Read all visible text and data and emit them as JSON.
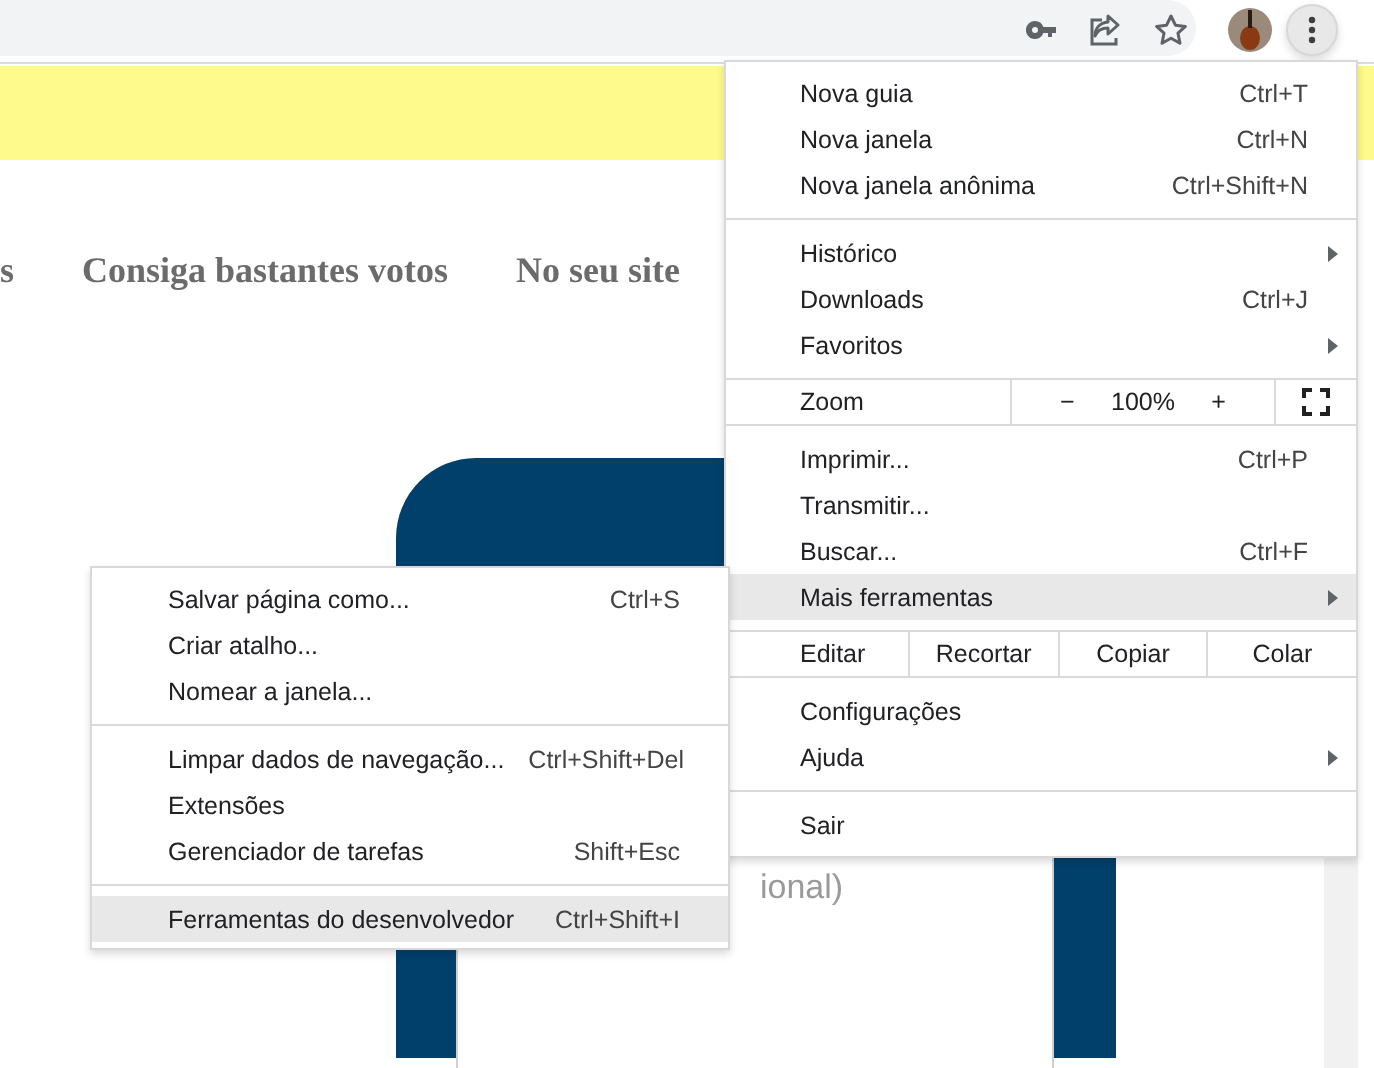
{
  "toolbar": {
    "icons": [
      {
        "kind": "key"
      },
      {
        "kind": "share"
      },
      {
        "kind": "star"
      },
      {
        "kind": "avatar"
      },
      {
        "kind": "menu",
        "selected": true
      }
    ]
  },
  "nav": {
    "links": [
      "s",
      "Consiga bastantes votos",
      "No seu site"
    ]
  },
  "form": {
    "field": {
      "placeholder": "ional)"
    }
  },
  "main_menu": {
    "items": [
      {
        "kind": "item",
        "label": "Nova guia",
        "shortcut": "Ctrl+T",
        "submenu": false,
        "selected": false
      },
      {
        "kind": "item",
        "label": "Nova janela",
        "shortcut": "Ctrl+N",
        "submenu": false,
        "selected": false
      },
      {
        "kind": "item",
        "label": "Nova janela anônima",
        "shortcut": "Ctrl+Shift+N",
        "submenu": false,
        "selected": false
      },
      {
        "kind": "separator"
      },
      {
        "kind": "item",
        "label": "Histórico",
        "submenu": true,
        "selected": false
      },
      {
        "kind": "item",
        "label": "Downloads",
        "shortcut": "Ctrl+J",
        "submenu": false,
        "selected": false
      },
      {
        "kind": "item",
        "label": "Favoritos",
        "submenu": true,
        "selected": false
      },
      {
        "kind": "zoom",
        "label": "Zoom",
        "minus": "−",
        "value": "100%",
        "plus": "+"
      },
      {
        "kind": "item",
        "label": "Imprimir...",
        "shortcut": "Ctrl+P",
        "submenu": false,
        "selected": false
      },
      {
        "kind": "item",
        "label": "Transmitir...",
        "submenu": false,
        "selected": false
      },
      {
        "kind": "item",
        "label": "Buscar...",
        "shortcut": "Ctrl+F",
        "submenu": false,
        "selected": false
      },
      {
        "kind": "item",
        "label": "Mais ferramentas",
        "submenu": true,
        "selected": true
      },
      {
        "kind": "edit",
        "label": "Editar",
        "buttons": [
          "Recortar",
          "Copiar",
          "Colar"
        ]
      },
      {
        "kind": "item",
        "label": "Configurações",
        "submenu": false,
        "selected": false
      },
      {
        "kind": "item",
        "label": "Ajuda",
        "submenu": true,
        "selected": false
      },
      {
        "kind": "separator"
      },
      {
        "kind": "item",
        "label": "Sair",
        "submenu": false,
        "selected": false
      }
    ]
  },
  "submenu": {
    "items": [
      {
        "kind": "item",
        "label": "Salvar página como...",
        "shortcut": "Ctrl+S",
        "selected": false
      },
      {
        "kind": "item",
        "label": "Criar atalho...",
        "selected": false
      },
      {
        "kind": "item",
        "label": "Nomear a janela...",
        "selected": false
      },
      {
        "kind": "separator"
      },
      {
        "kind": "item",
        "label": "Limpar dados de navegação...",
        "shortcut": "Ctrl+Shift+Del",
        "selected": false
      },
      {
        "kind": "item",
        "label": "Extensões",
        "selected": false
      },
      {
        "kind": "item",
        "label": "Gerenciador de tarefas",
        "shortcut": "Shift+Esc",
        "selected": false
      },
      {
        "kind": "separator"
      },
      {
        "kind": "item",
        "label": "Ferramentas do desenvolvedor",
        "shortcut": "Ctrl+Shift+I",
        "selected": true
      }
    ]
  }
}
